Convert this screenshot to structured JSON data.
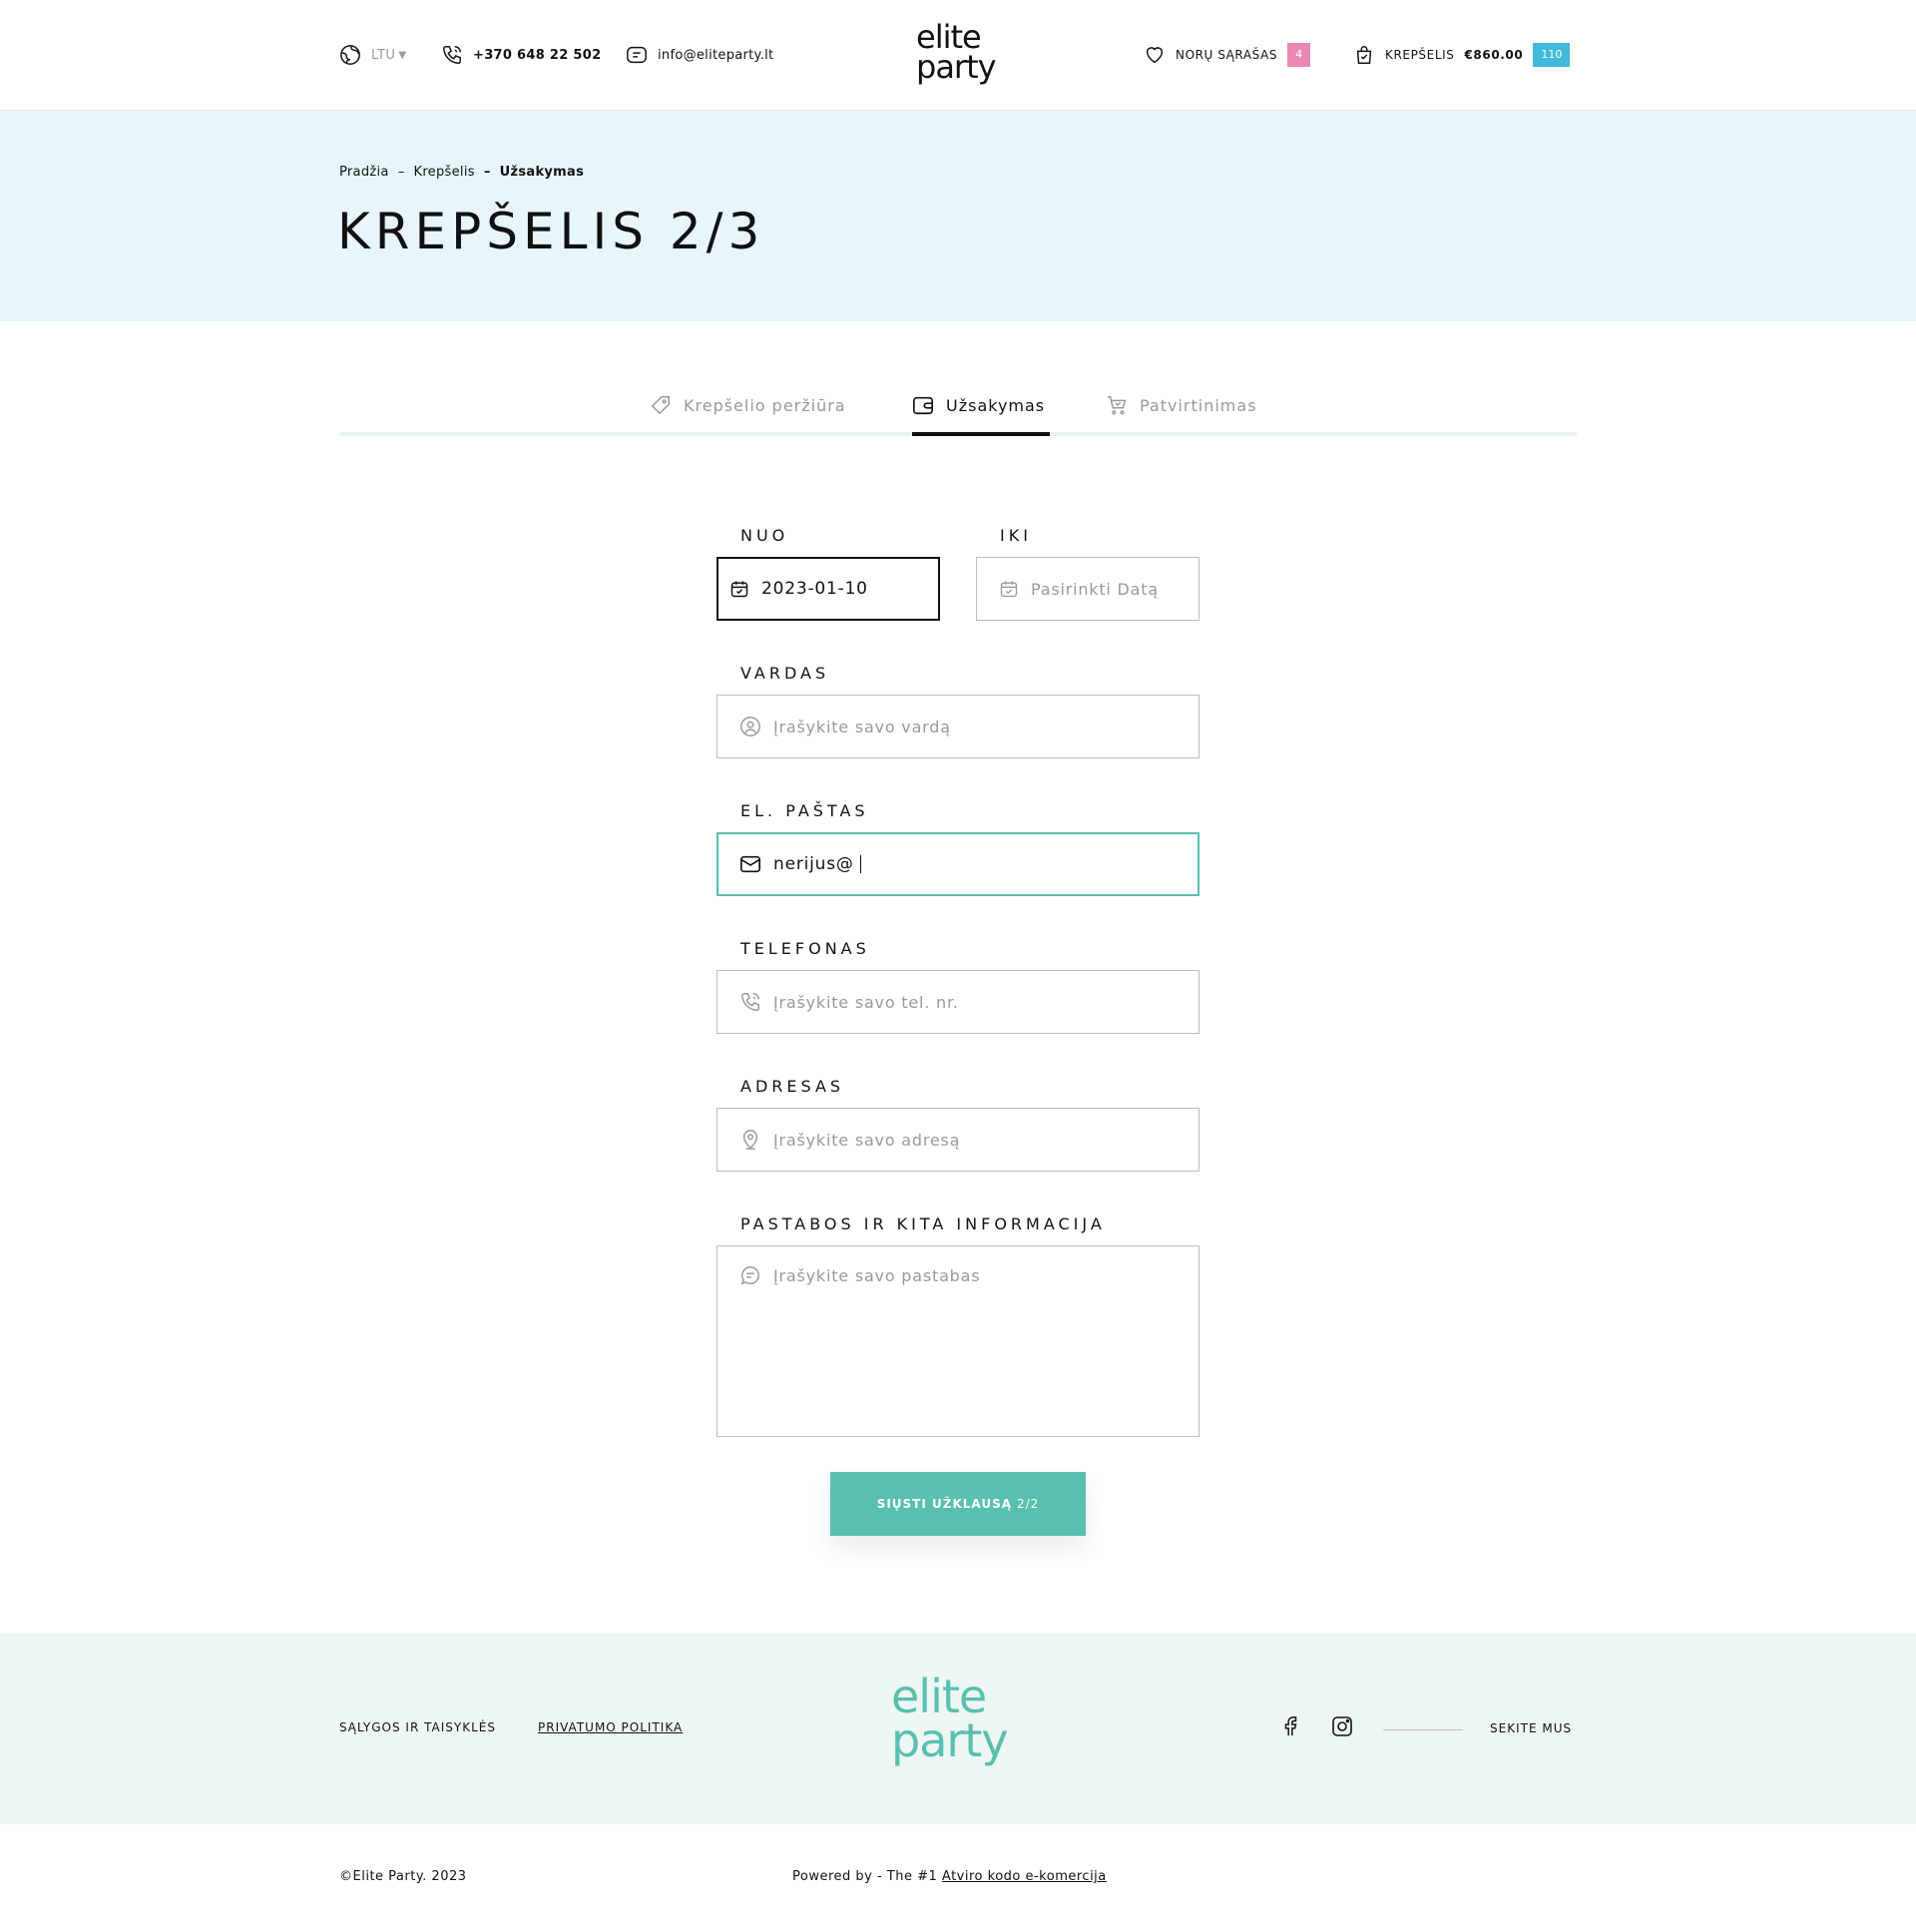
{
  "header": {
    "currency": "LTU",
    "phone": "+370 648 22 502",
    "email": "info@eliteparty.lt",
    "logo_line1": "elite",
    "logo_line2": "party",
    "wishlist_label": "NORŲ SĄRAŠAS",
    "wishlist_count": "4",
    "cart_label": "KREPŠELIS",
    "cart_total": "€860.00",
    "cart_count": "110",
    "colors": {
      "wishlist_badge": "#e889b4",
      "cart_badge": "#41b9d9"
    }
  },
  "hero": {
    "breadcrumb": [
      "Pradžia",
      "Krepšelis",
      "Užsakymas"
    ],
    "breadcrumb_sep": "–",
    "title": "KREPŠELIS 2/3",
    "background": "#e8f6fb"
  },
  "steps": [
    {
      "label": "Krepšelio peržiūra",
      "icon": "tag-icon",
      "active": false
    },
    {
      "label": "Užsakymas",
      "icon": "wallet-icon",
      "active": true
    },
    {
      "label": "Patvirtinimas",
      "icon": "cart-check-icon",
      "active": false
    }
  ],
  "form": {
    "from_label": "NUO",
    "from_value": "2023-01-10",
    "to_label": "IKI",
    "to_placeholder": "Pasirinkti Datą",
    "name_label": "VARDAS",
    "name_placeholder": "Įrašykite savo vardą",
    "email_label": "EL. PAŠTAS",
    "email_value": "nerijus@",
    "phone_label": "TELEFONAS",
    "phone_placeholder": "Įrašykite savo tel. nr.",
    "address_label": "ADRESAS",
    "address_placeholder": "Įrašykite savo adresą",
    "notes_label": "PASTABOS IR KITA INFORMACIJA",
    "notes_placeholder": "Įrašykite savo pastabas",
    "submit_label": "SIŲSTI UŽKLAUSĄ",
    "submit_step": "2/2",
    "accent": "#59bfaf"
  },
  "footer": {
    "terms": "SĄLYGOS IR TAISYKLĖS",
    "privacy": "PRIVATUMO POLITIKA",
    "logo_line1": "elite",
    "logo_line2": "party",
    "follow": "SEKITE MUS",
    "copyright": "©Elite Party. 2023",
    "powered_prefix": "Powered by - The #1",
    "powered_link": "Atviro kodo e-komercija",
    "background": "#eef6f4"
  }
}
